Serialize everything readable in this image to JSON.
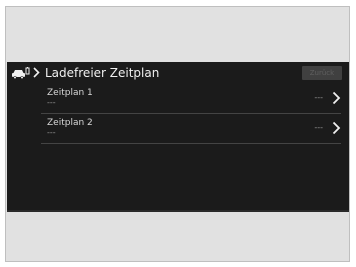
{
  "header": {
    "title": "Ladefreier Zeitplan",
    "back_label": "Zurück"
  },
  "icons": {
    "car": "car-charge-icon",
    "breadcrumb": "chevron-right-icon",
    "row_arrow": "chevron-right-icon"
  },
  "schedules": [
    {
      "label": "Zeitplan 1",
      "detail": "---",
      "value": "---"
    },
    {
      "label": "Zeitplan 2",
      "detail": "---",
      "value": "---"
    }
  ],
  "colors": {
    "screen_background": "#1b1b1b",
    "bezel": "#e1e1e1",
    "text_primary": "#f0f0f0",
    "text_secondary": "#9a9a9a"
  }
}
